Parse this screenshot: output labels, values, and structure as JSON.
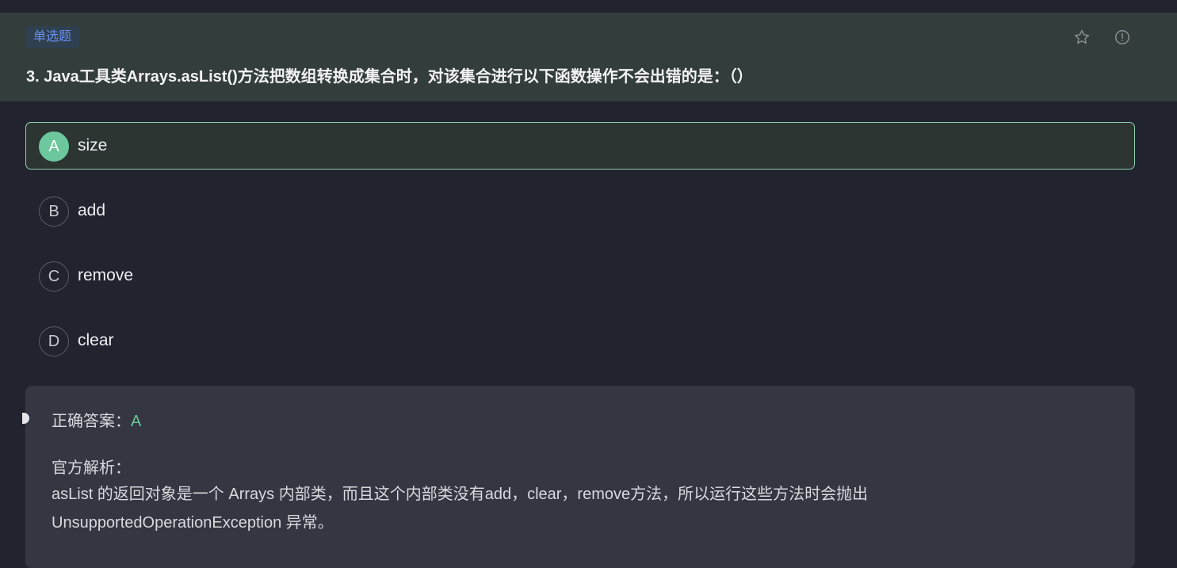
{
  "question": {
    "type_badge": "单选题",
    "title": "3. Java工具类Arrays.asList()方法把数组转换成集合时，对该集合进行以下函数操作不会出错的是：（）"
  },
  "header_icons": {
    "star": "star-icon",
    "report": "exclamation-circle-icon"
  },
  "options": [
    {
      "letter": "A",
      "text": "size",
      "selected": true
    },
    {
      "letter": "B",
      "text": "add",
      "selected": false
    },
    {
      "letter": "C",
      "text": "remove",
      "selected": false
    },
    {
      "letter": "D",
      "text": "clear",
      "selected": false
    }
  ],
  "explanation": {
    "answer_label": "正确答案：",
    "answer_value": "A",
    "analysis_label": "官方解析：",
    "analysis_text": "asList 的返回对象是一个 Arrays 内部类，而且这个内部类没有add，clear，remove方法，所以运行这些方法时会抛出UnsupportedOperationException 异常。"
  },
  "colors": {
    "accent_green": "#6cc79c",
    "badge_blue": "#6a8ff0",
    "header_bg": "#333d3b",
    "page_bg": "#21232e"
  }
}
